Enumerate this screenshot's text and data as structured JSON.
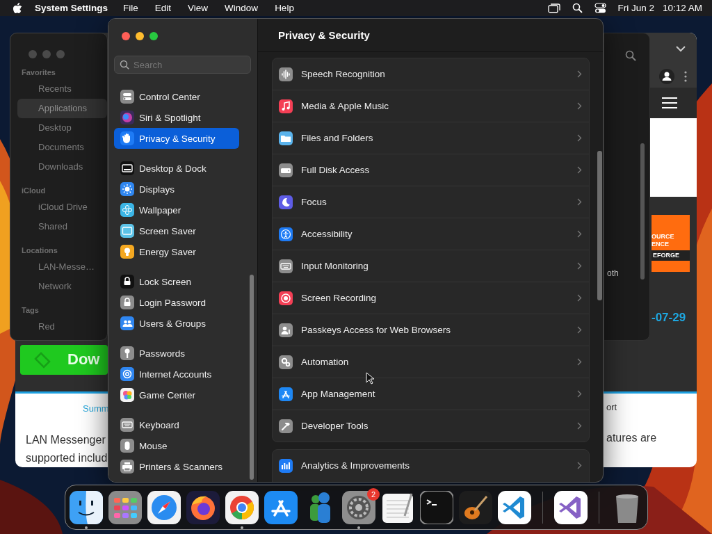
{
  "menu_bar": {
    "app": "System Settings",
    "menus": [
      "File",
      "Edit",
      "View",
      "Window",
      "Help"
    ],
    "date": "Fri Jun 2",
    "time": "10:12 AM"
  },
  "finder_window": {
    "sections": [
      {
        "title": "Favorites",
        "items": [
          {
            "label": "Recents",
            "selected": false
          },
          {
            "label": "Applications",
            "selected": true
          },
          {
            "label": "Desktop",
            "selected": false
          },
          {
            "label": "Documents",
            "selected": false
          },
          {
            "label": "Downloads",
            "selected": false
          }
        ]
      },
      {
        "title": "iCloud",
        "items": [
          {
            "label": "iCloud Drive",
            "selected": false
          },
          {
            "label": "Shared",
            "selected": false
          }
        ]
      },
      {
        "title": "Locations",
        "items": [
          {
            "label": "LAN-Messe…",
            "selected": false
          },
          {
            "label": "Network",
            "selected": false
          }
        ]
      },
      {
        "title": "Tags",
        "items": [
          {
            "label": "Red",
            "selected": false
          }
        ]
      }
    ]
  },
  "browser_window": {
    "download_button": "Dow",
    "badge_lines": [
      "OURCE",
      "ENCE",
      "EFORGE"
    ],
    "date_fragment": "-07-29",
    "tab_link": "Summ",
    "tab_link_right": "ort",
    "paragraph": "LAN Messenger supported includ",
    "paragraph_right": "atures are"
  },
  "back_window": {
    "label": "oth"
  },
  "settings_window": {
    "title": "Privacy & Security",
    "search": {
      "placeholder": "Search"
    },
    "sidebar": [
      [
        {
          "label": "Control Center",
          "kind": "toggles",
          "selected": false
        },
        {
          "label": "Siri & Spotlight",
          "kind": "siri",
          "selected": false
        },
        {
          "label": "Privacy & Security",
          "kind": "hand",
          "selected": true
        }
      ],
      [
        {
          "label": "Desktop & Dock",
          "kind": "dock",
          "selected": false
        },
        {
          "label": "Displays",
          "kind": "sun",
          "selected": false
        },
        {
          "label": "Wallpaper",
          "kind": "flower",
          "selected": false
        },
        {
          "label": "Screen Saver",
          "kind": "screen",
          "selected": false
        },
        {
          "label": "Energy Saver",
          "kind": "bulb",
          "selected": false
        }
      ],
      [
        {
          "label": "Lock Screen",
          "kind": "lockdark",
          "selected": false
        },
        {
          "label": "Login Password",
          "kind": "lock",
          "selected": false
        },
        {
          "label": "Users & Groups",
          "kind": "people",
          "selected": false
        }
      ],
      [
        {
          "label": "Passwords",
          "kind": "key",
          "selected": false
        },
        {
          "label": "Internet Accounts",
          "kind": "at",
          "selected": false
        },
        {
          "label": "Game Center",
          "kind": "bubbles",
          "selected": false
        }
      ],
      [
        {
          "label": "Keyboard",
          "kind": "keyboard",
          "selected": false
        },
        {
          "label": "Mouse",
          "kind": "mouse",
          "selected": false
        },
        {
          "label": "Printers & Scanners",
          "kind": "printer",
          "selected": false
        }
      ]
    ],
    "content": [
      [
        {
          "label": "Speech Recognition",
          "kind": "waveform"
        },
        {
          "label": "Media & Apple Music",
          "kind": "note"
        },
        {
          "label": "Files and Folders",
          "kind": "folder"
        },
        {
          "label": "Full Disk Access",
          "kind": "drive"
        },
        {
          "label": "Focus",
          "kind": "moon"
        },
        {
          "label": "Accessibility",
          "kind": "person"
        },
        {
          "label": "Input Monitoring",
          "kind": "keyboard"
        },
        {
          "label": "Screen Recording",
          "kind": "record"
        },
        {
          "label": "Passkeys Access for Web Browsers",
          "kind": "personkey"
        },
        {
          "label": "Automation",
          "kind": "gear"
        },
        {
          "label": "App Management",
          "kind": "appstore"
        },
        {
          "label": "Developer Tools",
          "kind": "hammer"
        }
      ],
      [
        {
          "label": "Analytics & Improvements",
          "kind": "bars"
        }
      ]
    ]
  },
  "dock": {
    "apps": [
      {
        "kind": "finder",
        "running": true
      },
      {
        "kind": "launchpad",
        "running": false
      },
      {
        "kind": "safari",
        "running": false
      },
      {
        "kind": "firefox",
        "running": false
      },
      {
        "kind": "chrome",
        "running": true
      },
      {
        "kind": "appstore",
        "running": false
      },
      {
        "kind": "messenger",
        "running": false
      },
      {
        "kind": "settings",
        "running": true,
        "badge": "2"
      },
      {
        "kind": "textedit",
        "running": false
      },
      {
        "kind": "terminal",
        "running": false
      },
      {
        "kind": "guitar",
        "running": false
      },
      {
        "kind": "vscode",
        "running": false
      },
      {
        "kind": "divider"
      },
      {
        "kind": "vstudio",
        "running": false
      },
      {
        "kind": "divider"
      },
      {
        "kind": "trash",
        "running": false
      }
    ]
  }
}
